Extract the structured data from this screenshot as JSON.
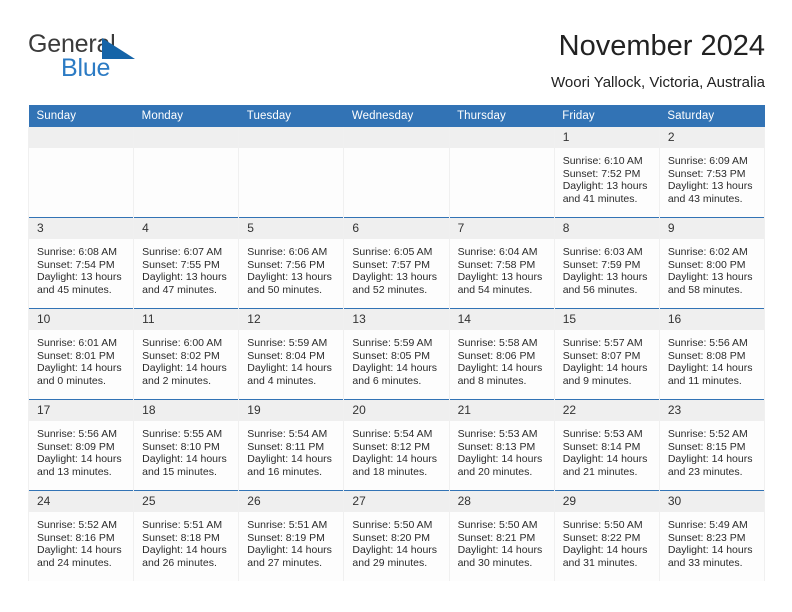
{
  "brand": {
    "name_part1": "General",
    "name_part2": "Blue",
    "triangle_color": "#1564a8",
    "blue_text_color": "#2c7bc4"
  },
  "header": {
    "title": "November 2024",
    "subtitle": "Woori Yallock, Victoria, Australia"
  },
  "theme": {
    "header_blue": "#3273b5",
    "daynum_band": "#efefef",
    "cell_background": "#fdfdfd"
  },
  "weekday_headers": [
    "Sunday",
    "Monday",
    "Tuesday",
    "Wednesday",
    "Thursday",
    "Friday",
    "Saturday"
  ],
  "weeks": [
    [
      {
        "day": "",
        "sunrise": "",
        "sunset": "",
        "daylight_line1": "",
        "daylight_line2": "",
        "empty": true
      },
      {
        "day": "",
        "sunrise": "",
        "sunset": "",
        "daylight_line1": "",
        "daylight_line2": "",
        "empty": true
      },
      {
        "day": "",
        "sunrise": "",
        "sunset": "",
        "daylight_line1": "",
        "daylight_line2": "",
        "empty": true
      },
      {
        "day": "",
        "sunrise": "",
        "sunset": "",
        "daylight_line1": "",
        "daylight_line2": "",
        "empty": true
      },
      {
        "day": "",
        "sunrise": "",
        "sunset": "",
        "daylight_line1": "",
        "daylight_line2": "",
        "empty": true
      },
      {
        "day": "1",
        "sunrise": "Sunrise: 6:10 AM",
        "sunset": "Sunset: 7:52 PM",
        "daylight_line1": "Daylight: 13 hours",
        "daylight_line2": "and 41 minutes.",
        "empty": false
      },
      {
        "day": "2",
        "sunrise": "Sunrise: 6:09 AM",
        "sunset": "Sunset: 7:53 PM",
        "daylight_line1": "Daylight: 13 hours",
        "daylight_line2": "and 43 minutes.",
        "empty": false
      }
    ],
    [
      {
        "day": "3",
        "sunrise": "Sunrise: 6:08 AM",
        "sunset": "Sunset: 7:54 PM",
        "daylight_line1": "Daylight: 13 hours",
        "daylight_line2": "and 45 minutes.",
        "empty": false
      },
      {
        "day": "4",
        "sunrise": "Sunrise: 6:07 AM",
        "sunset": "Sunset: 7:55 PM",
        "daylight_line1": "Daylight: 13 hours",
        "daylight_line2": "and 47 minutes.",
        "empty": false
      },
      {
        "day": "5",
        "sunrise": "Sunrise: 6:06 AM",
        "sunset": "Sunset: 7:56 PM",
        "daylight_line1": "Daylight: 13 hours",
        "daylight_line2": "and 50 minutes.",
        "empty": false
      },
      {
        "day": "6",
        "sunrise": "Sunrise: 6:05 AM",
        "sunset": "Sunset: 7:57 PM",
        "daylight_line1": "Daylight: 13 hours",
        "daylight_line2": "and 52 minutes.",
        "empty": false
      },
      {
        "day": "7",
        "sunrise": "Sunrise: 6:04 AM",
        "sunset": "Sunset: 7:58 PM",
        "daylight_line1": "Daylight: 13 hours",
        "daylight_line2": "and 54 minutes.",
        "empty": false
      },
      {
        "day": "8",
        "sunrise": "Sunrise: 6:03 AM",
        "sunset": "Sunset: 7:59 PM",
        "daylight_line1": "Daylight: 13 hours",
        "daylight_line2": "and 56 minutes.",
        "empty": false
      },
      {
        "day": "9",
        "sunrise": "Sunrise: 6:02 AM",
        "sunset": "Sunset: 8:00 PM",
        "daylight_line1": "Daylight: 13 hours",
        "daylight_line2": "and 58 minutes.",
        "empty": false
      }
    ],
    [
      {
        "day": "10",
        "sunrise": "Sunrise: 6:01 AM",
        "sunset": "Sunset: 8:01 PM",
        "daylight_line1": "Daylight: 14 hours",
        "daylight_line2": "and 0 minutes.",
        "empty": false
      },
      {
        "day": "11",
        "sunrise": "Sunrise: 6:00 AM",
        "sunset": "Sunset: 8:02 PM",
        "daylight_line1": "Daylight: 14 hours",
        "daylight_line2": "and 2 minutes.",
        "empty": false
      },
      {
        "day": "12",
        "sunrise": "Sunrise: 5:59 AM",
        "sunset": "Sunset: 8:04 PM",
        "daylight_line1": "Daylight: 14 hours",
        "daylight_line2": "and 4 minutes.",
        "empty": false
      },
      {
        "day": "13",
        "sunrise": "Sunrise: 5:59 AM",
        "sunset": "Sunset: 8:05 PM",
        "daylight_line1": "Daylight: 14 hours",
        "daylight_line2": "and 6 minutes.",
        "empty": false
      },
      {
        "day": "14",
        "sunrise": "Sunrise: 5:58 AM",
        "sunset": "Sunset: 8:06 PM",
        "daylight_line1": "Daylight: 14 hours",
        "daylight_line2": "and 8 minutes.",
        "empty": false
      },
      {
        "day": "15",
        "sunrise": "Sunrise: 5:57 AM",
        "sunset": "Sunset: 8:07 PM",
        "daylight_line1": "Daylight: 14 hours",
        "daylight_line2": "and 9 minutes.",
        "empty": false
      },
      {
        "day": "16",
        "sunrise": "Sunrise: 5:56 AM",
        "sunset": "Sunset: 8:08 PM",
        "daylight_line1": "Daylight: 14 hours",
        "daylight_line2": "and 11 minutes.",
        "empty": false
      }
    ],
    [
      {
        "day": "17",
        "sunrise": "Sunrise: 5:56 AM",
        "sunset": "Sunset: 8:09 PM",
        "daylight_line1": "Daylight: 14 hours",
        "daylight_line2": "and 13 minutes.",
        "empty": false
      },
      {
        "day": "18",
        "sunrise": "Sunrise: 5:55 AM",
        "sunset": "Sunset: 8:10 PM",
        "daylight_line1": "Daylight: 14 hours",
        "daylight_line2": "and 15 minutes.",
        "empty": false
      },
      {
        "day": "19",
        "sunrise": "Sunrise: 5:54 AM",
        "sunset": "Sunset: 8:11 PM",
        "daylight_line1": "Daylight: 14 hours",
        "daylight_line2": "and 16 minutes.",
        "empty": false
      },
      {
        "day": "20",
        "sunrise": "Sunrise: 5:54 AM",
        "sunset": "Sunset: 8:12 PM",
        "daylight_line1": "Daylight: 14 hours",
        "daylight_line2": "and 18 minutes.",
        "empty": false
      },
      {
        "day": "21",
        "sunrise": "Sunrise: 5:53 AM",
        "sunset": "Sunset: 8:13 PM",
        "daylight_line1": "Daylight: 14 hours",
        "daylight_line2": "and 20 minutes.",
        "empty": false
      },
      {
        "day": "22",
        "sunrise": "Sunrise: 5:53 AM",
        "sunset": "Sunset: 8:14 PM",
        "daylight_line1": "Daylight: 14 hours",
        "daylight_line2": "and 21 minutes.",
        "empty": false
      },
      {
        "day": "23",
        "sunrise": "Sunrise: 5:52 AM",
        "sunset": "Sunset: 8:15 PM",
        "daylight_line1": "Daylight: 14 hours",
        "daylight_line2": "and 23 minutes.",
        "empty": false
      }
    ],
    [
      {
        "day": "24",
        "sunrise": "Sunrise: 5:52 AM",
        "sunset": "Sunset: 8:16 PM",
        "daylight_line1": "Daylight: 14 hours",
        "daylight_line2": "and 24 minutes.",
        "empty": false
      },
      {
        "day": "25",
        "sunrise": "Sunrise: 5:51 AM",
        "sunset": "Sunset: 8:18 PM",
        "daylight_line1": "Daylight: 14 hours",
        "daylight_line2": "and 26 minutes.",
        "empty": false
      },
      {
        "day": "26",
        "sunrise": "Sunrise: 5:51 AM",
        "sunset": "Sunset: 8:19 PM",
        "daylight_line1": "Daylight: 14 hours",
        "daylight_line2": "and 27 minutes.",
        "empty": false
      },
      {
        "day": "27",
        "sunrise": "Sunrise: 5:50 AM",
        "sunset": "Sunset: 8:20 PM",
        "daylight_line1": "Daylight: 14 hours",
        "daylight_line2": "and 29 minutes.",
        "empty": false
      },
      {
        "day": "28",
        "sunrise": "Sunrise: 5:50 AM",
        "sunset": "Sunset: 8:21 PM",
        "daylight_line1": "Daylight: 14 hours",
        "daylight_line2": "and 30 minutes.",
        "empty": false
      },
      {
        "day": "29",
        "sunrise": "Sunrise: 5:50 AM",
        "sunset": "Sunset: 8:22 PM",
        "daylight_line1": "Daylight: 14 hours",
        "daylight_line2": "and 31 minutes.",
        "empty": false
      },
      {
        "day": "30",
        "sunrise": "Sunrise: 5:49 AM",
        "sunset": "Sunset: 8:23 PM",
        "daylight_line1": "Daylight: 14 hours",
        "daylight_line2": "and 33 minutes.",
        "empty": false
      }
    ]
  ]
}
